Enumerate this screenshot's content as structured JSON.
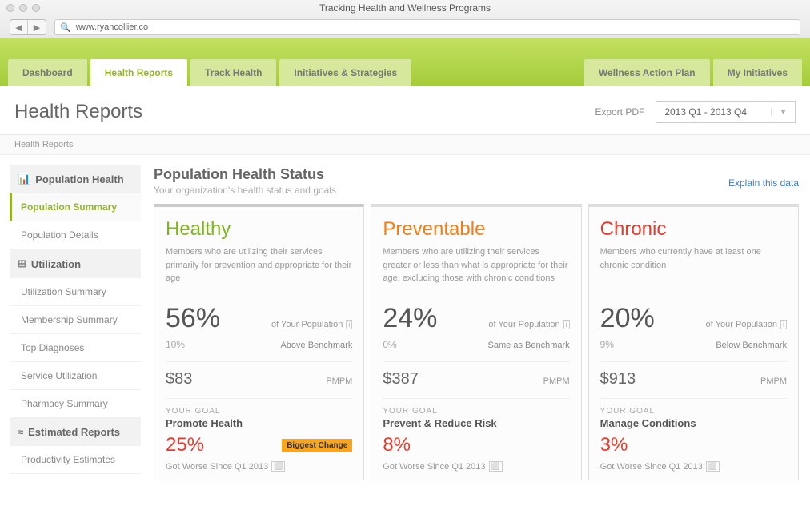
{
  "window": {
    "title": "Tracking Health and Wellness Programs",
    "url": "www.ryancollier.co"
  },
  "nav": {
    "tabs_left": [
      "Dashboard",
      "Health Reports",
      "Track Health",
      "Initiatives & Strategies"
    ],
    "tabs_right": [
      "Wellness Action Plan",
      "My Initiatives"
    ],
    "active": "Health Reports"
  },
  "page": {
    "title": "Health Reports",
    "export": "Export PDF",
    "date_range": "2013 Q1 - 2013 Q4",
    "breadcrumb": "Health Reports"
  },
  "sidebar": {
    "sections": [
      {
        "label": "Population Health",
        "icon": "chart",
        "items": [
          {
            "label": "Population Summary",
            "active": true
          },
          {
            "label": "Population Details"
          }
        ]
      },
      {
        "label": "Utilization",
        "icon": "grid",
        "items": [
          {
            "label": "Utilization Summary"
          },
          {
            "label": "Membership Summary"
          },
          {
            "label": "Top Diagnoses"
          },
          {
            "label": "Service Utilization"
          },
          {
            "label": "Pharmacy Summary"
          }
        ]
      },
      {
        "label": "Estimated Reports",
        "icon": "approx",
        "items": [
          {
            "label": "Productivity Estimates"
          }
        ]
      }
    ]
  },
  "main": {
    "title": "Population Health Status",
    "subtitle": "Your organization's health status and goals",
    "explain": "Explain this data",
    "pop_label": "of Your Population",
    "benchmark_word": "Benchmark",
    "pmpm": "PMPM",
    "goal_label": "YOUR GOAL",
    "badge": "Biggest Change"
  },
  "cards": [
    {
      "key": "healthy",
      "title": "Healthy",
      "desc": "Members who are utilizing their services primarily for prevention and appropriate for their age",
      "pct": "56%",
      "delta": "10%",
      "bench_rel": "Above",
      "cost": "$83",
      "goal_name": "Promote Health",
      "goal_pct": "25%",
      "badge": true,
      "trend": "Got Worse Since Q1 2013"
    },
    {
      "key": "preventable",
      "title": "Preventable",
      "desc": "Members who are utilizing their services greater or less than what is appropriate for their age, excluding those with chronic conditions",
      "pct": "24%",
      "delta": "0%",
      "bench_rel": "Same as",
      "cost": "$387",
      "goal_name": "Prevent & Reduce Risk",
      "goal_pct": "8%",
      "badge": false,
      "trend": "Got Worse Since Q1 2013"
    },
    {
      "key": "chronic",
      "title": "Chronic",
      "desc": "Members who currently have at least one chronic condition",
      "pct": "20%",
      "delta": "9%",
      "bench_rel": "Below",
      "cost": "$913",
      "goal_name": "Manage Conditions",
      "goal_pct": "3%",
      "badge": false,
      "trend": "Got Worse Since Q1 2013"
    }
  ]
}
